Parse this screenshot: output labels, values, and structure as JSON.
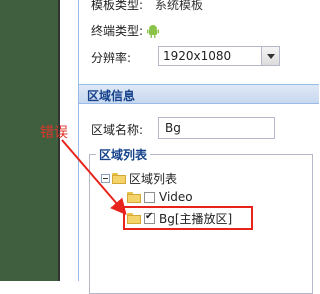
{
  "properties": {
    "template_type_label": "模板类型:",
    "template_type_value": "系统模板",
    "device_type_label": "终端类型:",
    "device_type_icon": "android-icon",
    "resolution_label": "分辨率:",
    "resolution_value": "1920x1080"
  },
  "region_info": {
    "title": "区域信息",
    "name_label": "区域名称:",
    "name_value": "Bg"
  },
  "region_list": {
    "legend": "区域列表",
    "root": "区域列表",
    "items": [
      {
        "label": "Video",
        "checked": false
      },
      {
        "label": "Bg[主播放区]",
        "checked": true
      }
    ]
  },
  "annotation": {
    "error_text": "错误",
    "color": "#e8231c"
  },
  "colors": {
    "canvas_bg": "#3f5f3f",
    "header_text": "#15428b",
    "annotation_red": "#e8231c"
  }
}
